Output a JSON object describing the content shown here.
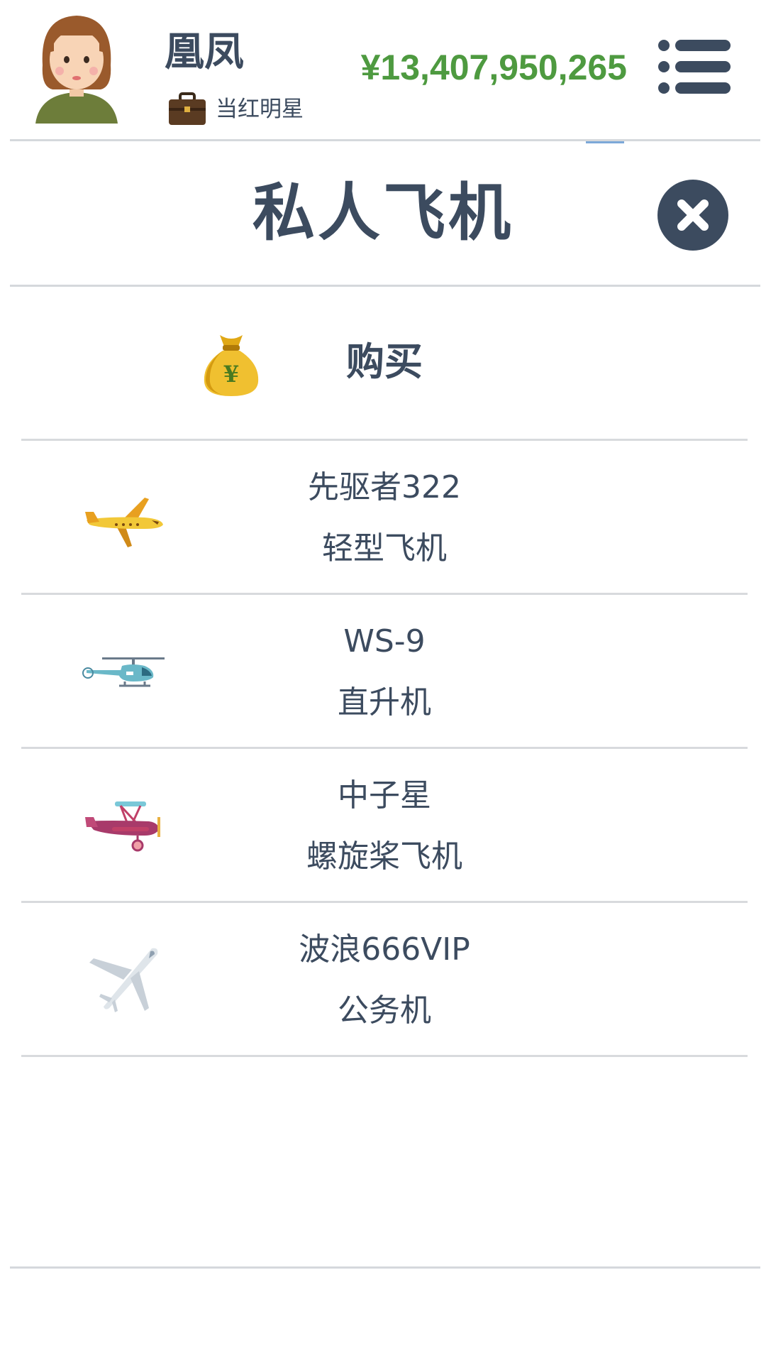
{
  "player": {
    "name": "凰凤",
    "job_title": "当红明星",
    "money": "¥13,407,950,265"
  },
  "page": {
    "title": "私人飞机"
  },
  "buy": {
    "label": "购买",
    "icon": "money-bag-icon"
  },
  "aircraft": [
    {
      "name": "先驱者322",
      "type": "轻型飞机",
      "icon": "light-plane-icon"
    },
    {
      "name": "WS-9",
      "type": "直升机",
      "icon": "helicopter-icon"
    },
    {
      "name": "中子星",
      "type": "螺旋桨飞机",
      "icon": "biplane-icon"
    },
    {
      "name": "波浪666VIP",
      "type": "公务机",
      "icon": "business-jet-icon"
    }
  ],
  "colors": {
    "text": "#3c4b5f",
    "money": "#4e9a40",
    "divider": "#d5d8dc",
    "button": "#3c4b5f"
  }
}
